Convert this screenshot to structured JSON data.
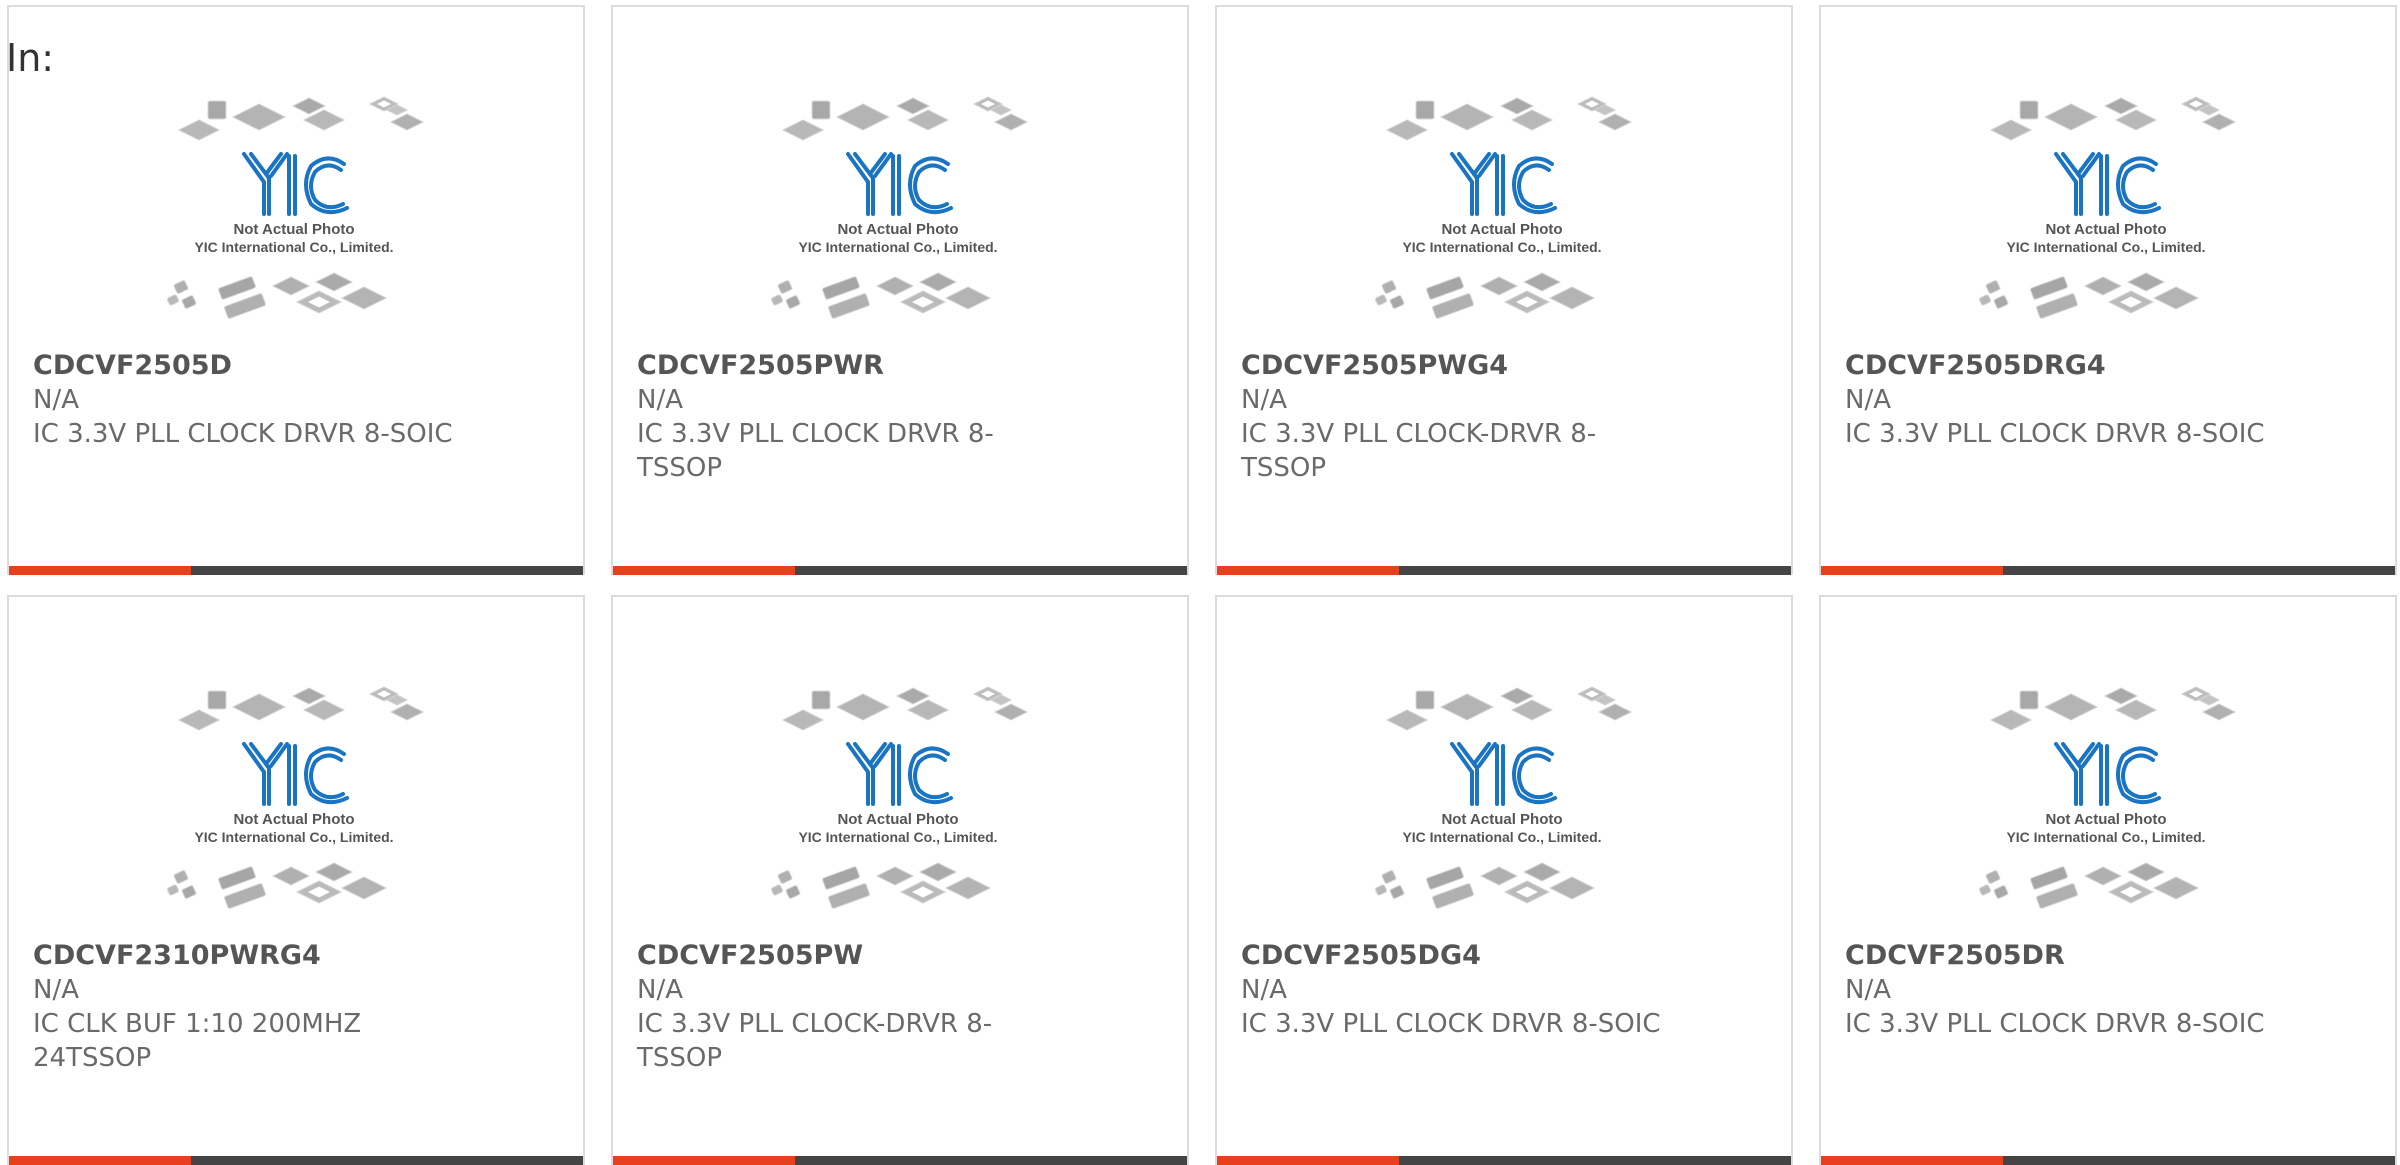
{
  "filter_label": "In:",
  "colors": {
    "accent": "#e8401c",
    "bar": "#444444",
    "logo_blue": "#1a74c4",
    "chip_gray": "#b8b8b8"
  },
  "placeholder": {
    "line1": "Not Actual Photo",
    "line2": "YIC International Co., Limited.",
    "logo_text": "YIC"
  },
  "products": [
    {
      "part_number": "CDCVF2505D",
      "manufacturer": "N/A",
      "description": "IC 3.3V PLL CLOCK DRVR 8-SOIC"
    },
    {
      "part_number": "CDCVF2505PWR",
      "manufacturer": "N/A",
      "description": "IC 3.3V PLL CLOCK DRVR 8-TSSOP"
    },
    {
      "part_number": "CDCVF2505PWG4",
      "manufacturer": "N/A",
      "description": "IC 3.3V PLL CLOCK-DRVR 8-TSSOP"
    },
    {
      "part_number": "CDCVF2505DRG4",
      "manufacturer": "N/A",
      "description": "IC 3.3V PLL CLOCK DRVR 8-SOIC"
    },
    {
      "part_number": "CDCVF2310PWRG4",
      "manufacturer": "N/A",
      "description": "IC CLK BUF 1:10 200MHZ 24TSSOP"
    },
    {
      "part_number": "CDCVF2505PW",
      "manufacturer": "N/A",
      "description": "IC 3.3V PLL CLOCK-DRVR 8-TSSOP"
    },
    {
      "part_number": "CDCVF2505DG4",
      "manufacturer": "N/A",
      "description": "IC 3.3V PLL CLOCK DRVR 8-SOIC"
    },
    {
      "part_number": "CDCVF2505DR",
      "manufacturer": "N/A",
      "description": "IC 3.3V PLL CLOCK DRVR 8-SOIC"
    }
  ]
}
